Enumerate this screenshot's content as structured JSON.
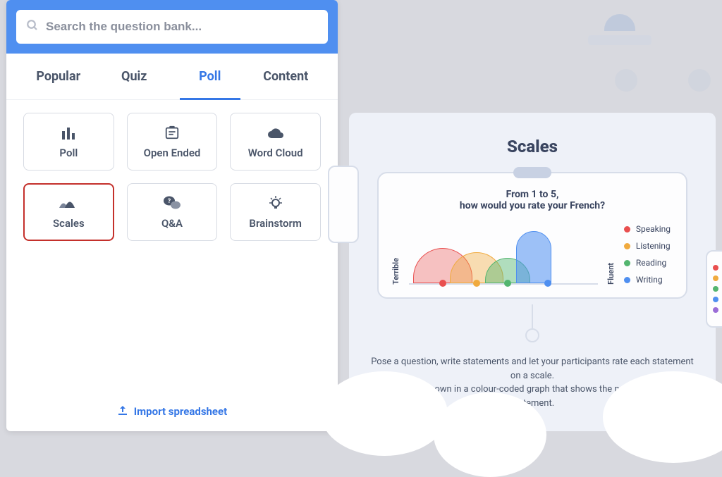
{
  "search": {
    "placeholder": "Search the question bank..."
  },
  "tabs": [
    {
      "id": "popular",
      "label": "Popular",
      "active": false
    },
    {
      "id": "quiz",
      "label": "Quiz",
      "active": false
    },
    {
      "id": "poll",
      "label": "Poll",
      "active": true
    },
    {
      "id": "content",
      "label": "Content",
      "active": false
    }
  ],
  "cards": [
    {
      "id": "poll",
      "label": "Poll",
      "icon": "poll-icon",
      "selected": false
    },
    {
      "id": "open-ended",
      "label": "Open Ended",
      "icon": "open-ended-icon",
      "selected": false
    },
    {
      "id": "word-cloud",
      "label": "Word Cloud",
      "icon": "cloud-icon",
      "selected": false
    },
    {
      "id": "scales",
      "label": "Scales",
      "icon": "scales-icon",
      "selected": true
    },
    {
      "id": "qa",
      "label": "Q&A",
      "icon": "qa-icon",
      "selected": false
    },
    {
      "id": "brainstorm",
      "label": "Brainstorm",
      "icon": "brainstorm-icon",
      "selected": false
    }
  ],
  "import_label": "Import spreadsheet",
  "preview": {
    "title": "Scales",
    "question_line1": "From 1 to 5,",
    "question_line2": "how would you rate your French?",
    "axis_low": "Terrible",
    "axis_high": "Fluent",
    "legend": [
      {
        "label": "Speaking",
        "color": "#e94f4f"
      },
      {
        "label": "Listening",
        "color": "#f0aa3e"
      },
      {
        "label": "Reading",
        "color": "#53b56f"
      },
      {
        "label": "Writing",
        "color": "#4f8ff0"
      }
    ],
    "description_line1": "Pose a question, write statements and let your participants rate each statement on a scale.",
    "description_line2": "Results are shown in a colour-coded graph that shows the popularity of each statement."
  },
  "chart_data": {
    "type": "area",
    "title": "From 1 to 5, how would you rate your French?",
    "xlabel": "",
    "ylabel": "",
    "x_axis_endpoints": [
      "Terrible",
      "Fluent"
    ],
    "xlim": [
      1,
      5
    ],
    "series": [
      {
        "name": "Speaking",
        "color": "#e94f4f",
        "peak_x": 2,
        "peak_height": 0.62
      },
      {
        "name": "Listening",
        "color": "#f0aa3e",
        "peak_x": 3,
        "peak_height": 0.54
      },
      {
        "name": "Reading",
        "color": "#53b56f",
        "peak_x": 3.7,
        "peak_height": 0.45
      },
      {
        "name": "Writing",
        "color": "#4f8ff0",
        "peak_x": 4.5,
        "peak_height": 0.95
      }
    ]
  },
  "colors": {
    "accent": "#3577e6",
    "header": "#4f8ff0",
    "text": "#4a5569",
    "selected_border": "#c4302b"
  }
}
